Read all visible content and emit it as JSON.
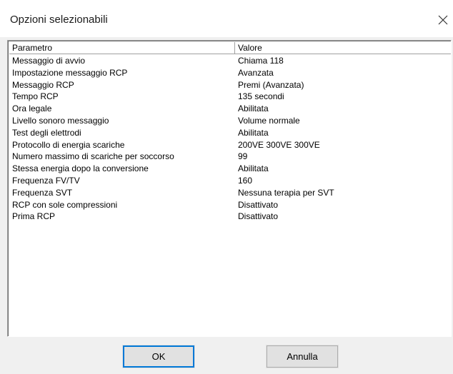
{
  "window": {
    "title": "Opzioni selezionabili",
    "close_icon": "close-icon"
  },
  "list": {
    "columns": [
      "Parametro",
      "Valore"
    ],
    "rows": [
      [
        "Messaggio di avvio",
        "Chiama 118"
      ],
      [
        "Impostazione messaggio RCP",
        "Avanzata"
      ],
      [
        "Messaggio RCP",
        "Premi (Avanzata)"
      ],
      [
        "Tempo RCP",
        "135 secondi"
      ],
      [
        "Ora legale",
        "Abilitata"
      ],
      [
        "Livello sonoro messaggio",
        "Volume normale"
      ],
      [
        "Test degli elettrodi",
        "Abilitata"
      ],
      [
        "Protocollo di energia scariche",
        "200VE  300VE  300VE"
      ],
      [
        "Numero massimo di scariche per soccorso",
        "99"
      ],
      [
        "Stessa energia dopo la conversione",
        "Abilitata"
      ],
      [
        "Frequenza FV/TV",
        "160"
      ],
      [
        "Frequenza SVT",
        "Nessuna terapia per SVT"
      ],
      [
        "RCP con sole compressioni",
        "Disattivato"
      ],
      [
        "Prima RCP",
        "Disattivato"
      ]
    ]
  },
  "buttons": {
    "ok_label": "OK",
    "cancel_label": "Annulla"
  },
  "colors": {
    "dialog_background": "#f0f0f0",
    "default_button_border": "#0078d7"
  }
}
